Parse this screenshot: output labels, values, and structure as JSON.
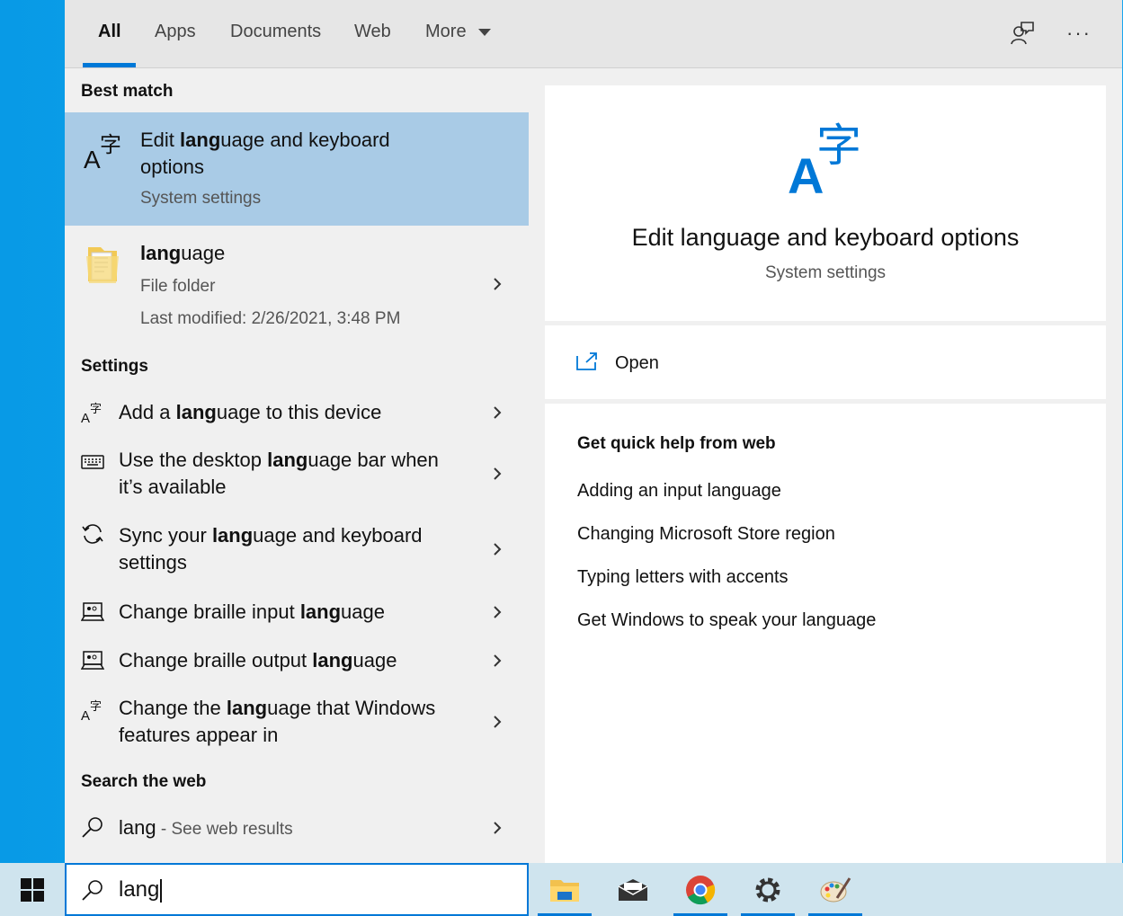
{
  "tabs": [
    {
      "label": "All"
    },
    {
      "label": "Apps"
    },
    {
      "label": "Documents"
    },
    {
      "label": "Web"
    },
    {
      "label": "More"
    }
  ],
  "toolbar": {
    "feedback_icon": "feedback-icon",
    "more_icon": "ellipsis-icon",
    "more_label": "···"
  },
  "left": {
    "best_match_header": "Best match",
    "best_match": {
      "title_prefix": "Edit ",
      "title_bold": "lang",
      "title_line1_rest": "uage and keyboard",
      "title_line2": "options",
      "subtitle": "System settings",
      "icon": "language-icon"
    },
    "folder": {
      "title_bold": "lang",
      "title_rest": "uage",
      "type": "File folder",
      "modified": "Last modified: 2/26/2021, 3:48 PM",
      "icon": "folder-icon"
    },
    "settings_header": "Settings",
    "settings": [
      {
        "pre": "Add a ",
        "bold": "lang",
        "post": "uage to this device",
        "line2": "",
        "icon": "language-icon"
      },
      {
        "pre": "Use the desktop ",
        "bold": "lang",
        "post": "uage bar when",
        "line2": "it’s available",
        "icon": "keyboard-icon"
      },
      {
        "pre": "Sync your ",
        "bold": "lang",
        "post": "uage and keyboard",
        "line2": "settings",
        "icon": "sync-icon"
      },
      {
        "pre": "Change braille input ",
        "bold": "lang",
        "post": "uage",
        "line2": "",
        "icon": "braille-icon"
      },
      {
        "pre": "Change braille output ",
        "bold": "lang",
        "post": "uage",
        "line2": "",
        "icon": "braille-icon"
      },
      {
        "pre": "Change the ",
        "bold": "lang",
        "post": "uage that Windows",
        "line2": "features appear in",
        "icon": "language-icon"
      }
    ],
    "web_header": "Search the web",
    "web": {
      "query": "lang",
      "suffix": " - See web results",
      "icon": "search-icon"
    }
  },
  "right": {
    "title": "Edit language and keyboard options",
    "subtitle": "System settings",
    "open_label": "Open",
    "help_header": "Get quick help from web",
    "help_links": [
      "Adding an input language",
      "Changing Microsoft Store region",
      "Typing letters with accents",
      "Get Windows to speak your language"
    ]
  },
  "taskbar": {
    "search_value": "lang",
    "apps": [
      "file-explorer-icon",
      "mail-icon",
      "chrome-icon",
      "settings-gear-icon",
      "paint-icon"
    ]
  },
  "colors": {
    "accent": "#0078d7",
    "selected_bg": "#a9cbe6"
  }
}
